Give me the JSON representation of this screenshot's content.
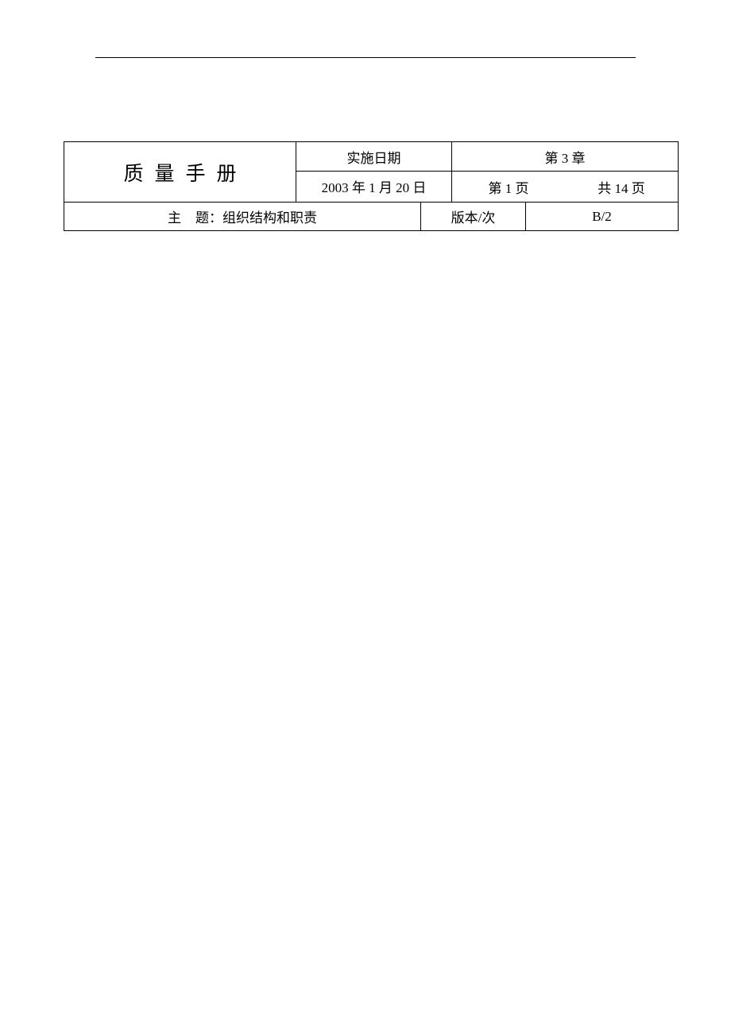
{
  "header": {
    "title": "质量手册",
    "implementDateLabel": "实施日期",
    "implementDate": "2003 年 1 月 20 日",
    "chapter": "第 3 章",
    "pageCurrent": "第 1 页",
    "pageTotal": "共 14 页"
  },
  "subject": {
    "prefix": "主",
    "label": "题：组织结构和职责",
    "versionLabel": "版本/次",
    "versionValue": "B/2"
  }
}
